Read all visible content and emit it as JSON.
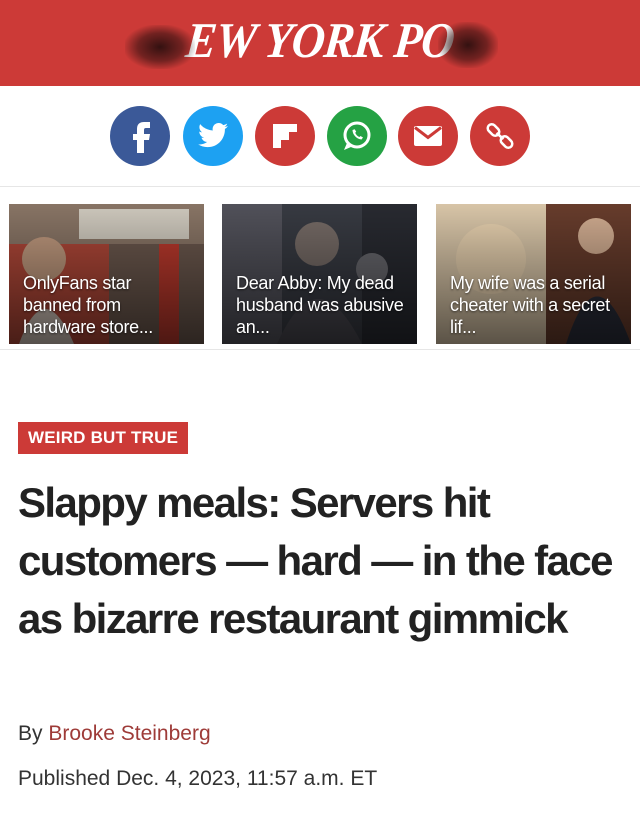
{
  "masthead": {
    "logo_text": "EW YORK PO",
    "brand_color": "#cc3a37"
  },
  "share": {
    "buttons": [
      {
        "name": "facebook",
        "icon": "facebook-icon",
        "color": "#3b5998"
      },
      {
        "name": "twitter",
        "icon": "twitter-icon",
        "color": "#1da1f2"
      },
      {
        "name": "flipboard",
        "icon": "flipboard-icon",
        "color": "#cc3a37"
      },
      {
        "name": "whatsapp",
        "icon": "whatsapp-icon",
        "color": "#25a244"
      },
      {
        "name": "email",
        "icon": "email-icon",
        "color": "#cc3a37"
      },
      {
        "name": "copy-link",
        "icon": "link-icon",
        "color": "#cc3a37"
      }
    ]
  },
  "related": [
    {
      "title": "OnlyFans star banned from hardware store..."
    },
    {
      "title": "Dear Abby: My dead husband was abusive an..."
    },
    {
      "title": "My wife was a serial cheater with a secret lif..."
    }
  ],
  "article": {
    "kicker": "WEIRD BUT TRUE",
    "headline": "Slappy meals: Servers hit customers — hard — in the face as bizarre restaurant gimmick",
    "byline_prefix": "By",
    "author": "Brooke Steinberg",
    "published": "Published Dec. 4, 2023, 11:57 a.m. ET"
  }
}
